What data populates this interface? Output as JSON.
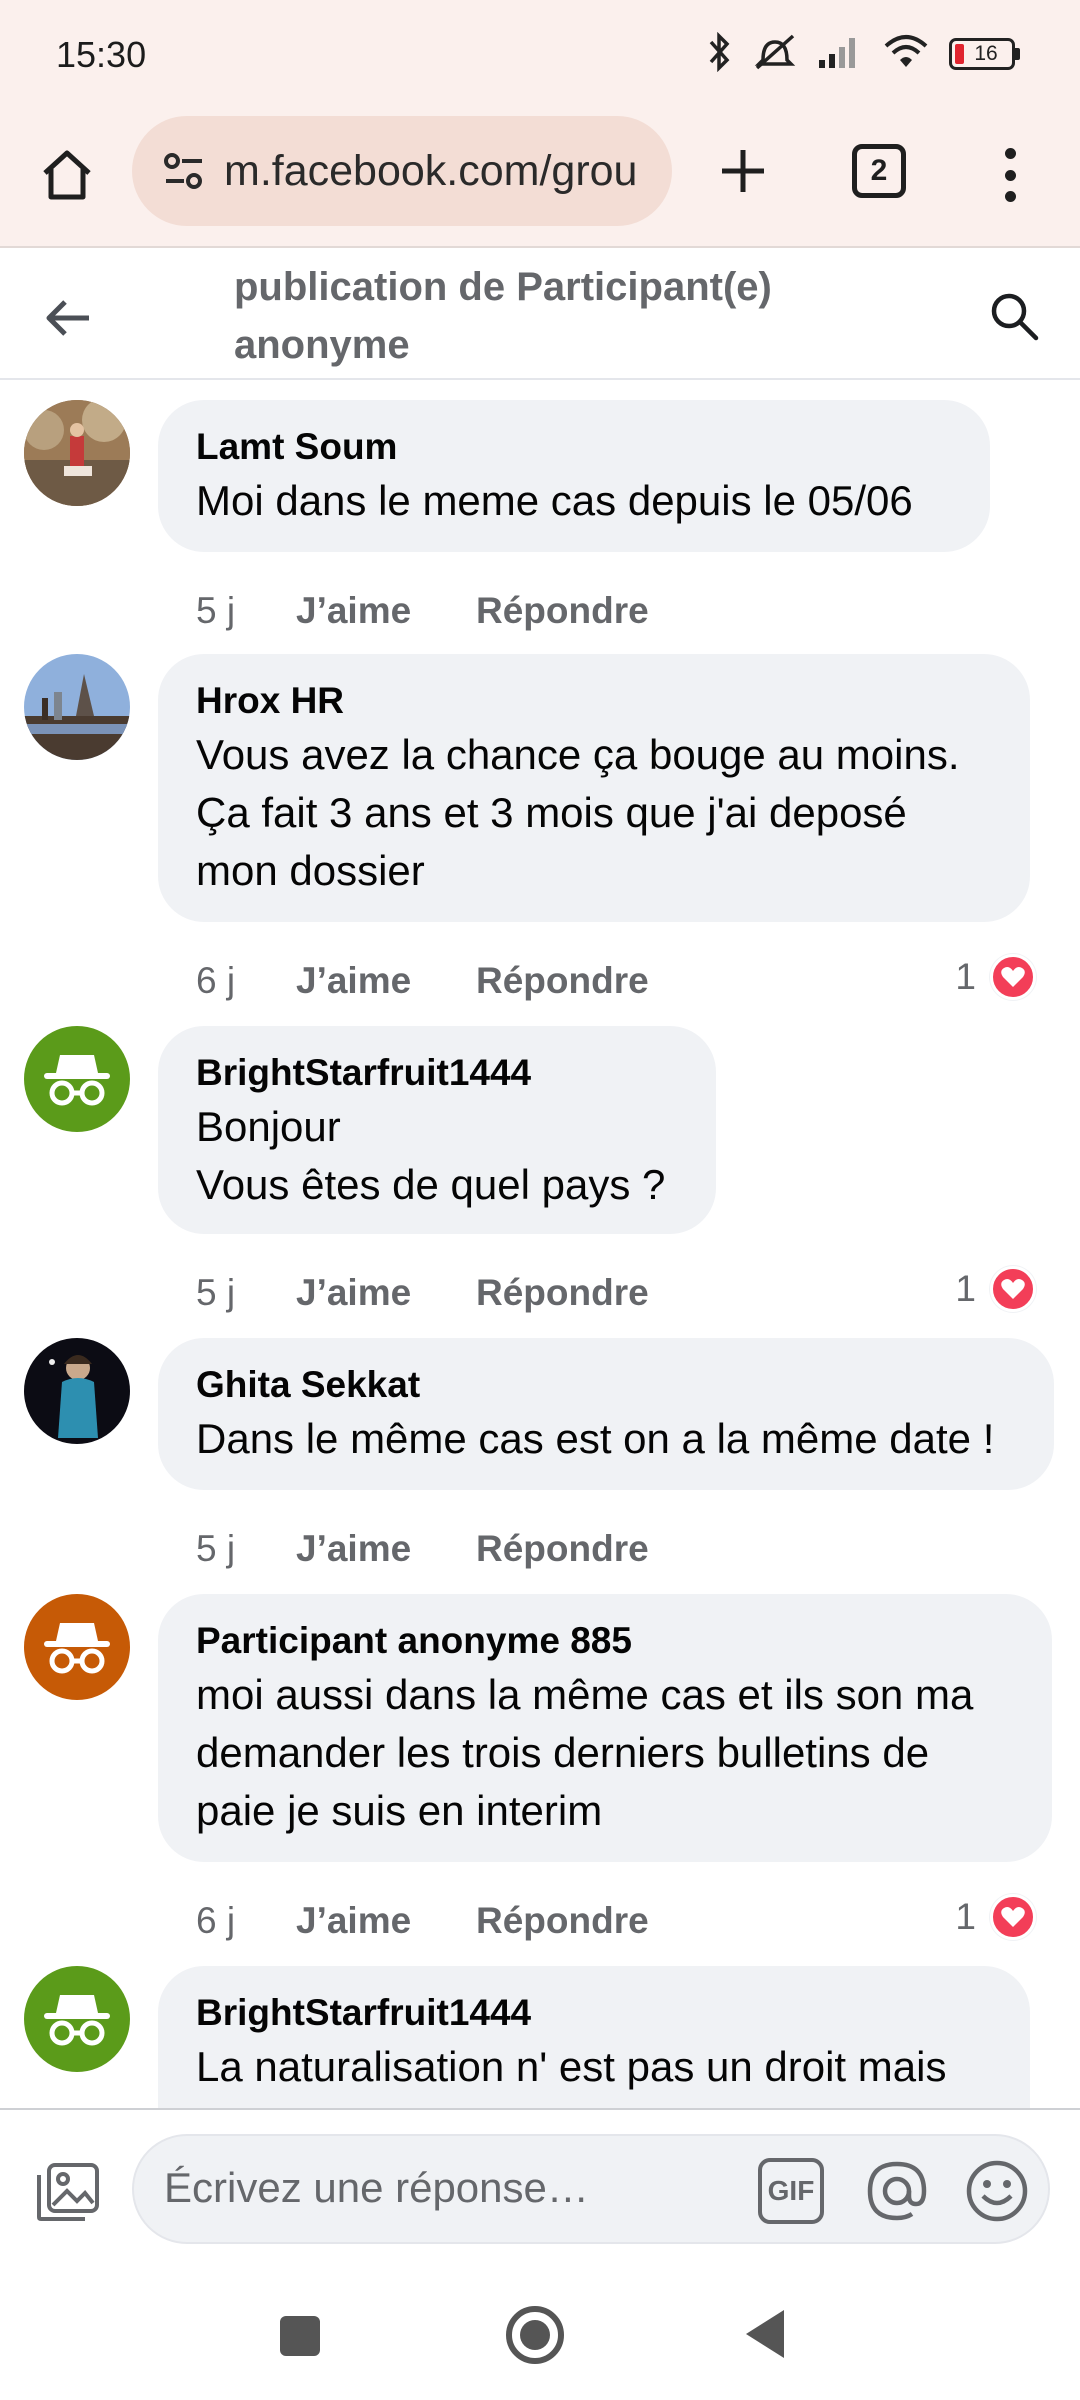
{
  "status_bar": {
    "time": "15:30",
    "battery": "16",
    "icons": [
      "bluetooth-icon",
      "silent-icon",
      "signal-icon",
      "wifi-icon",
      "battery-icon"
    ]
  },
  "browser": {
    "url": "m.facebook.com/grou",
    "tab_count": "2"
  },
  "header": {
    "title": "publication de Participant(e) anonyme"
  },
  "comments": [
    {
      "author": "Lamt Soum",
      "text": "Moi dans le meme cas depuis le 05/06",
      "time": "5 j",
      "like": "J’aime",
      "reply": "Répondre",
      "reaction_count": ""
    },
    {
      "author": "Hrox HR",
      "text": "Vous avez la chance ça bouge au moins.\nÇa fait 3 ans et 3 mois que j'ai deposé\nmon dossier",
      "time": "6 j",
      "like": "J’aime",
      "reply": "Répondre",
      "reaction_count": "1"
    },
    {
      "author": "BrightStarfruit1444",
      "text": "Bonjour\nVous êtes de quel pays ?",
      "time": "5 j",
      "like": "J’aime",
      "reply": "Répondre",
      "reaction_count": "1"
    },
    {
      "author": "Ghita Sekkat",
      "text": "Dans le même cas est on a la même date !",
      "time": "5 j",
      "like": "J’aime",
      "reply": "Répondre",
      "reaction_count": ""
    },
    {
      "author": "Participant anonyme 885",
      "text": "moi aussi dans la même cas et ils son ma\ndemander les trois derniers bulletins de\npaie je suis en interim",
      "time": "6 j",
      "like": "J’aime",
      "reply": "Répondre",
      "reaction_count": "1"
    },
    {
      "author": "BrightStarfruit1444",
      "text": "La naturalisation n' est pas un droit mais",
      "time": "",
      "like": "",
      "reply": "",
      "reaction_count": ""
    }
  ],
  "reply_bar": {
    "placeholder": "Écrivez une réponse…",
    "gif_label": "GIF"
  },
  "colors": {
    "anon_green": "#5b9b1a",
    "anon_orange": "#c65a06",
    "heart": "#f33e58",
    "bubble": "#f0f2f5",
    "secondary_text": "#65676b"
  }
}
